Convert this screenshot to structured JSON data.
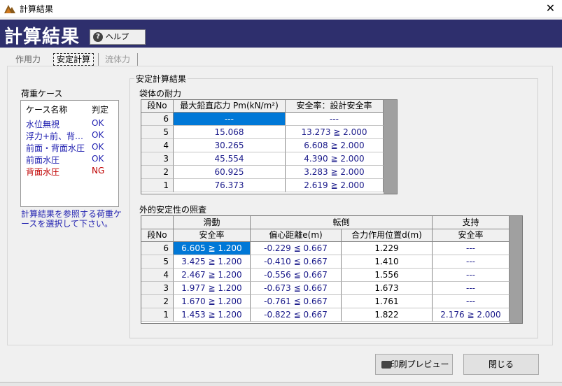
{
  "window": {
    "title": "計算結果",
    "close_glyph": "✕"
  },
  "header": {
    "title": "計算結果",
    "help_label": "ヘルプ",
    "help_icon": "?"
  },
  "tabs": [
    {
      "label": "作用力",
      "state": "normal"
    },
    {
      "label": "安定計算",
      "state": "active"
    },
    {
      "label": "流体力",
      "state": "disabled"
    }
  ],
  "cases": {
    "label": "荷重ケース",
    "col_name": "ケース名称",
    "col_judge": "判定",
    "items": [
      {
        "name": "水位無視",
        "judge": "OK",
        "color": "#1f1fb0"
      },
      {
        "name": "浮力+前、背…",
        "judge": "OK",
        "color": "#1f1fb0"
      },
      {
        "name": "前面・背面水圧",
        "judge": "OK",
        "color": "#1f1fb0"
      },
      {
        "name": "前面水圧",
        "judge": "OK",
        "color": "#1f1fb0"
      },
      {
        "name": "背面水圧",
        "judge": "NG",
        "color": "#c00000"
      }
    ],
    "note": "計算結果を参照する荷重ケースを選択して下さい。"
  },
  "result": {
    "group_title": "安定計算結果",
    "bag": {
      "title": "袋体の耐力",
      "headers": [
        "段No",
        "最大鉛直応力 Pm(kN/m²)",
        "安全率：設計安全率"
      ],
      "rows": [
        [
          "6",
          "---",
          "---"
        ],
        [
          "5",
          "15.068",
          "13.273 ≧ 2.000"
        ],
        [
          "4",
          "30.265",
          "6.608 ≧ 2.000"
        ],
        [
          "3",
          "45.554",
          "4.390 ≧ 2.000"
        ],
        [
          "2",
          "60.925",
          "3.283 ≧ 2.000"
        ],
        [
          "1",
          "76.373",
          "2.619 ≧ 2.000"
        ]
      ]
    },
    "external": {
      "title": "外的安定性の照査",
      "groups": [
        "滑動",
        "転倒",
        "支持"
      ],
      "headers": [
        "段No",
        "安全率",
        "偏心距離e(m)",
        "合力作用位置d(m)",
        "安全率"
      ],
      "rows": [
        [
          "6",
          "6.605 ≧ 1.200",
          "-0.229 ≦ 0.667",
          "1.229",
          "---"
        ],
        [
          "5",
          "3.425 ≧ 1.200",
          "-0.410 ≦ 0.667",
          "1.410",
          "---"
        ],
        [
          "4",
          "2.467 ≧ 1.200",
          "-0.556 ≦ 0.667",
          "1.556",
          "---"
        ],
        [
          "3",
          "1.977 ≧ 1.200",
          "-0.673 ≦ 0.667",
          "1.673",
          "---"
        ],
        [
          "2",
          "1.670 ≧ 1.200",
          "-0.761 ≦ 0.667",
          "1.761",
          "---"
        ],
        [
          "1",
          "1.453 ≧ 1.200",
          "-0.822 ≦ 0.667",
          "1.822",
          "2.176 ≧ 2.000"
        ]
      ]
    }
  },
  "buttons": {
    "print_preview": "印刷プレビュー",
    "close": "閉じる"
  },
  "icons": {
    "app": "app-logo-icon",
    "help": "help-icon",
    "printer": "printer-icon"
  }
}
